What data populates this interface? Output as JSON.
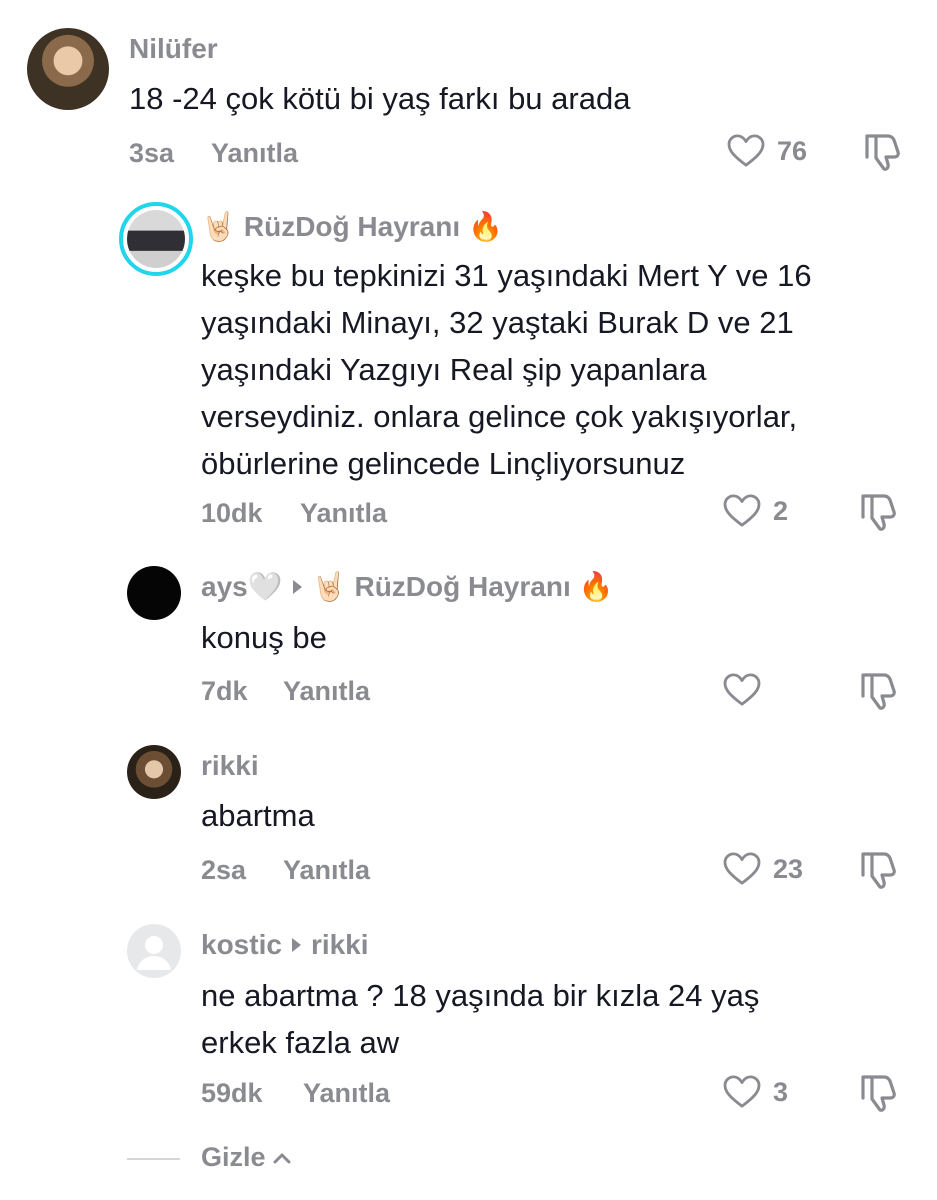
{
  "comments": [
    {
      "username": "Nilüfer",
      "text": [
        "18 -24 çok kötü bi yaş farkı bu arada"
      ],
      "time": "3sa",
      "reply_label": "Yanıtla",
      "likes": "76"
    },
    {
      "username": "RüzDoğ Hayranı",
      "text": [
        "keşke bu tepkinizi 31 yaşındaki Mert Y ve 16",
        "yaşındaki Minayı, 32 yaştaki Burak D ve 21",
        "yaşındaki Yazgıyı Real şip yapanlara",
        "verseydiniz. onlara gelince çok yakışıyorlar,",
        "öbürlerine gelincede Linçliyorsunuz"
      ],
      "time": "10dk",
      "reply_label": "Yanıtla",
      "likes": "2"
    },
    {
      "username": "ays🤍",
      "reply_to": "RüzDoğ Hayranı",
      "text": [
        "konuş be"
      ],
      "time": "7dk",
      "reply_label": "Yanıtla",
      "likes": ""
    },
    {
      "username": "rikki",
      "text": [
        "abartma"
      ],
      "time": "2sa",
      "reply_label": "Yanıtla",
      "likes": "23"
    },
    {
      "username": "kostic",
      "reply_to": "rikki",
      "text": [
        "ne abartma ? 18 yaşında bir kızla 24 yaş",
        "erkek fazla aw"
      ],
      "time": "59dk",
      "reply_label": "Yanıtla",
      "likes": "3"
    }
  ],
  "hide_label": "Gizle",
  "icons": {
    "like": "heart-outline-icon",
    "dislike": "thumbs-down-icon",
    "hide": "chevron-up-icon",
    "rock_hand": "🤘🏻",
    "fire": "🔥"
  },
  "colors": {
    "text_primary": "#161823",
    "text_secondary": "#8a8b91",
    "avatar_ring": "#20d5ec"
  }
}
